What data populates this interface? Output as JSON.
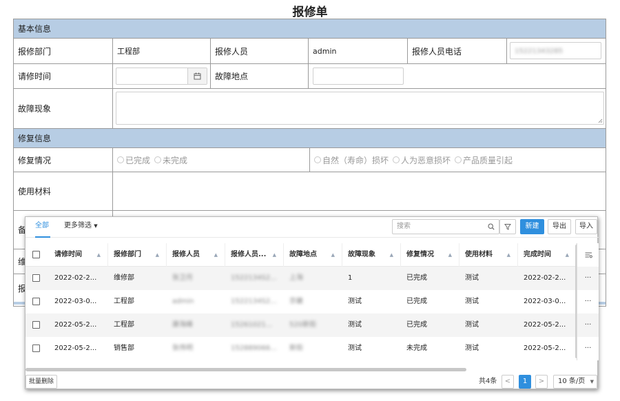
{
  "title": "报修单",
  "basic": {
    "section_label": "基本信息",
    "dept_label": "报修部门",
    "dept_value": "工程部",
    "reporter_label": "报修人员",
    "reporter_value": "admin",
    "phone_label": "报修人员电话",
    "phone_value": "15221343285",
    "time_label": "请修时间",
    "location_label": "故障地点",
    "symptom_label": "故障现象"
  },
  "repair": {
    "section_label": "修复信息",
    "status_label": "修复情况",
    "status_options": [
      "已完成",
      "未完成"
    ],
    "cause_options": [
      "自然（寿命）损坏",
      "人为恶意损坏",
      "产品质量引起"
    ],
    "material_label": "使用材料",
    "remark_label": "备",
    "maint_label": "维",
    "report_label": "报"
  },
  "panel": {
    "tabs": [
      "全部",
      "更多筛选"
    ],
    "search_placeholder": "搜索",
    "new_label": "新建",
    "export_label": "导出",
    "import_label": "导入",
    "columns": [
      "请修时间",
      "报修部门",
      "报修人员",
      "报修人员...",
      "故障地点",
      "故障现象",
      "修复情况",
      "使用材料",
      "完成时间"
    ],
    "rows": [
      [
        "2022-02-2...",
        "维修部",
        "张卫月",
        "1522134S2...",
        "上海",
        "1",
        "已完成",
        "测试",
        "2022-02-2..."
      ],
      [
        "2022-03-0...",
        "工程部",
        "admin",
        "1522134S2...",
        "京畿",
        "测试",
        "已完成",
        "测试",
        "2022-03-0..."
      ],
      [
        "2022-05-2...",
        "工程部",
        "康海峰",
        "15261021...",
        "520新街",
        "测试",
        "已完成",
        "测试",
        "2022-05-2..."
      ],
      [
        "2022-05-2...",
        "销售部",
        "张伟明",
        "152889066...",
        "新街",
        "测试",
        "未完成",
        "测试",
        "2022-05-2..."
      ]
    ],
    "more_glyph": "···",
    "batch_delete": "批量删除",
    "total": "共4条",
    "prev": "<",
    "current_page": "1",
    "next": ">",
    "page_size": "10 条/页"
  }
}
